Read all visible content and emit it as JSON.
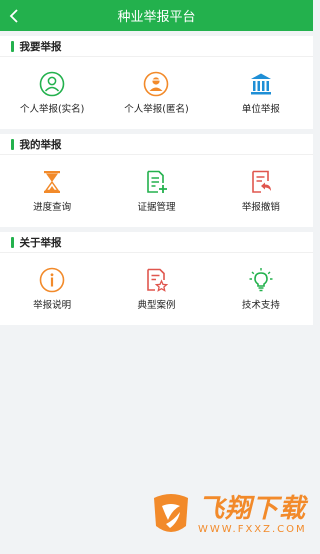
{
  "header": {
    "title": "种业举报平台"
  },
  "sections": [
    {
      "title": "我要举报",
      "items": [
        {
          "label": "个人举报(实名)",
          "icon": "person-real-name-icon"
        },
        {
          "label": "个人举报(匿名)",
          "icon": "person-anonymous-icon"
        },
        {
          "label": "单位举报",
          "icon": "building-icon"
        }
      ]
    },
    {
      "title": "我的举报",
      "items": [
        {
          "label": "进度查询",
          "icon": "hourglass-icon"
        },
        {
          "label": "证据管理",
          "icon": "document-add-icon"
        },
        {
          "label": "举报撤销",
          "icon": "document-undo-icon"
        }
      ]
    },
    {
      "title": "关于举报",
      "items": [
        {
          "label": "举报说明",
          "icon": "info-icon"
        },
        {
          "label": "典型案例",
          "icon": "document-star-icon"
        },
        {
          "label": "技术支持",
          "icon": "lightbulb-icon"
        }
      ]
    }
  ],
  "watermark": {
    "main": "飞翔下载",
    "sub": "WWW.FXXZ.COM"
  },
  "colors": {
    "brand": "#23b14d",
    "orange": "#f28a2a",
    "red": "#e0564e",
    "blue": "#1f8fd6"
  }
}
